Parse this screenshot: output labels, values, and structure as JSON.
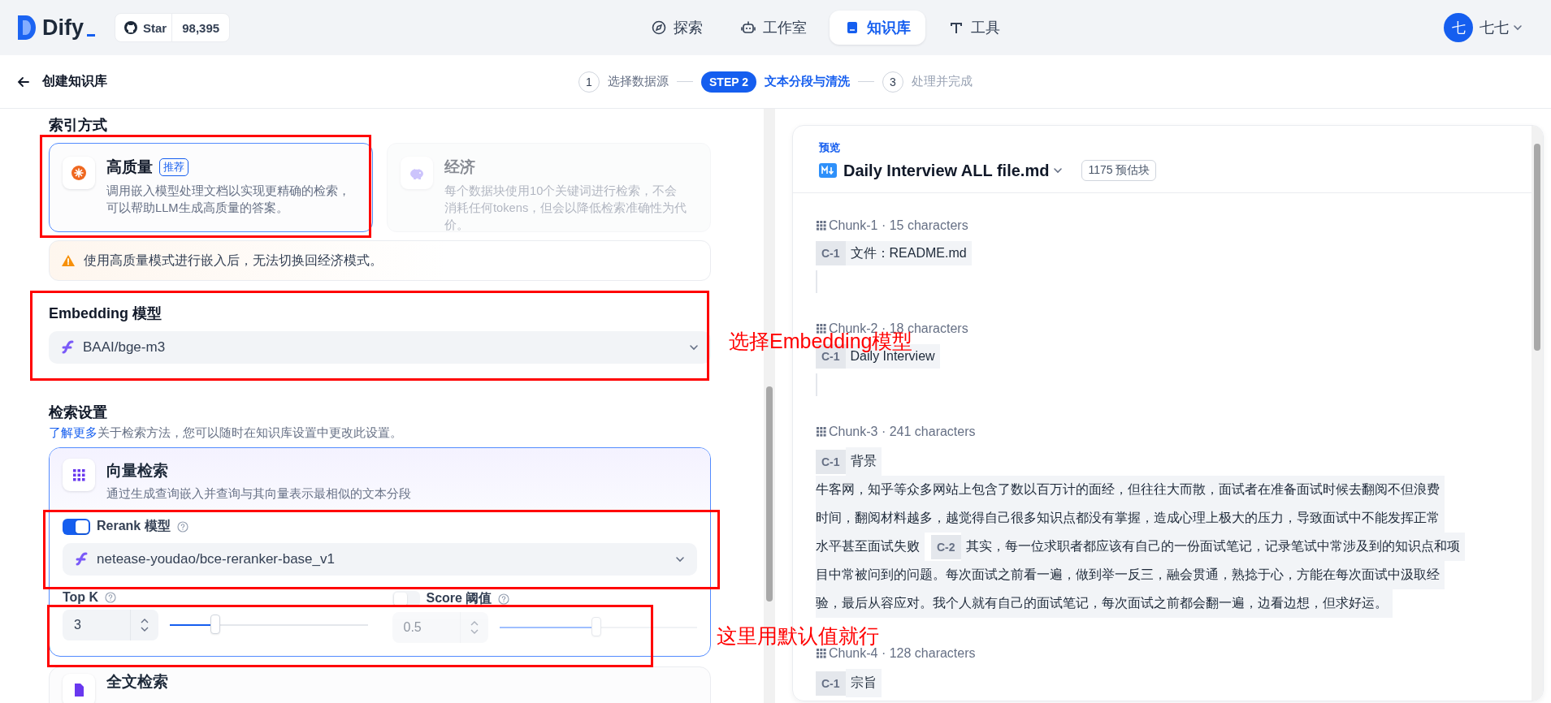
{
  "header": {
    "logo": "Dify",
    "github": {
      "label": "Star",
      "count": "98,395"
    },
    "nav": [
      {
        "label": "探索",
        "selected": false
      },
      {
        "label": "工作室",
        "selected": false
      },
      {
        "label": "知识库",
        "selected": true
      },
      {
        "label": "工具",
        "selected": false
      }
    ],
    "user": {
      "avatar": "七",
      "name": "七七"
    }
  },
  "subheader": {
    "title": "创建知识库",
    "steps": [
      {
        "number": "1",
        "label": "选择数据源",
        "selected": false
      },
      {
        "number": "STEP 2",
        "label": "文本分段与清洗",
        "selected": true
      },
      {
        "number": "3",
        "label": "处理并完成",
        "selected": false
      }
    ]
  },
  "index_method": {
    "title": "索引方式",
    "options": [
      {
        "title": "高质量",
        "badge": "推荐",
        "description": "调用嵌入模型处理文档以实现更精确的检索，可以帮助LLM生成高质量的答案。",
        "selected": true
      },
      {
        "title": "经济",
        "description": "每个数据块使用10个关键词进行检索，不会消耗任何tokens，但会以降低检索准确性为代价。",
        "selected": false
      }
    ],
    "warning": "使用高质量模式进行嵌入后，无法切换回经济模式。"
  },
  "embedding": {
    "label": "Embedding 模型",
    "value": "BAAI/bge-m3"
  },
  "retrieval": {
    "title": "检索设置",
    "link": "了解更多",
    "description": "关于检索方法，您可以随时在知识库设置中更改此设置。",
    "methods": [
      {
        "title": "向量检索",
        "description": "通过生成查询嵌入并查询与其向量表示最相似的文本分段",
        "selected": true,
        "rerank": {
          "on": true,
          "label": "Rerank 模型",
          "value": "netease-youdao/bce-reranker-base_v1"
        },
        "top_k": {
          "label": "Top K",
          "value": "3",
          "level": 0.23
        },
        "score": {
          "label": "Score 阈值",
          "on": false,
          "value": "0.5",
          "level": 0.49
        }
      },
      {
        "title": "全文检索",
        "selected": false
      }
    ]
  },
  "preview": {
    "label": "预览",
    "file": "Daily Interview ALL file.md",
    "estimate": "1175 预估块",
    "chunks": [
      {
        "header": "Chunk-1 · 15 characters",
        "empty_line": true,
        "lines": [
          [
            {
              "tag": "C-1",
              "text": "文件：README.md"
            }
          ]
        ]
      },
      {
        "header": "Chunk-2 · 18 characters",
        "empty_line": true,
        "lines": [
          [
            {
              "tag": "C-1",
              "text": "Daily Interview"
            }
          ]
        ]
      },
      {
        "header": "Chunk-3 · 241 characters",
        "empty_line": false,
        "lines": [
          [
            {
              "tag": "C-1",
              "text": "背景"
            }
          ],
          [
            {
              "text": "牛客网，知乎等众多网站上包含了数以百万计的面经，但往往大而散，面试者在准备面试时候去翻阅不但浪费"
            }
          ],
          [
            {
              "text": "时间，翻阅材料越多，越觉得自己很多知识点都没有掌握，造成心理上极大的压力，导致面试中不能发挥正常"
            }
          ],
          [
            {
              "text": "水平甚至面试失败"
            },
            {
              "tag": "C-2",
              "text": "其实，每一位求职者都应该有自己的一份面试笔记，记录笔试中常涉及到的知识点和项"
            }
          ],
          [
            {
              "text": "目中常被问到的问题。每次面试之前看一遍，做到举一反三，融会贯通，熟捻于心，方能在每次面试中汲取经"
            }
          ],
          [
            {
              "text": "验，最后从容应对。我个人就有自己的面试笔记，每次面试之前都会翻一遍，边看边想，但求好运。"
            }
          ]
        ]
      },
      {
        "header": "Chunk-4 · 128 characters",
        "empty_line": false,
        "lines": [
          [
            {
              "tag": "C-1",
              "text": "宗旨"
            }
          ]
        ]
      }
    ]
  },
  "annotations": [
    {
      "text": "选择Embedding模型"
    },
    {
      "text": "这里用默认值就行"
    }
  ]
}
